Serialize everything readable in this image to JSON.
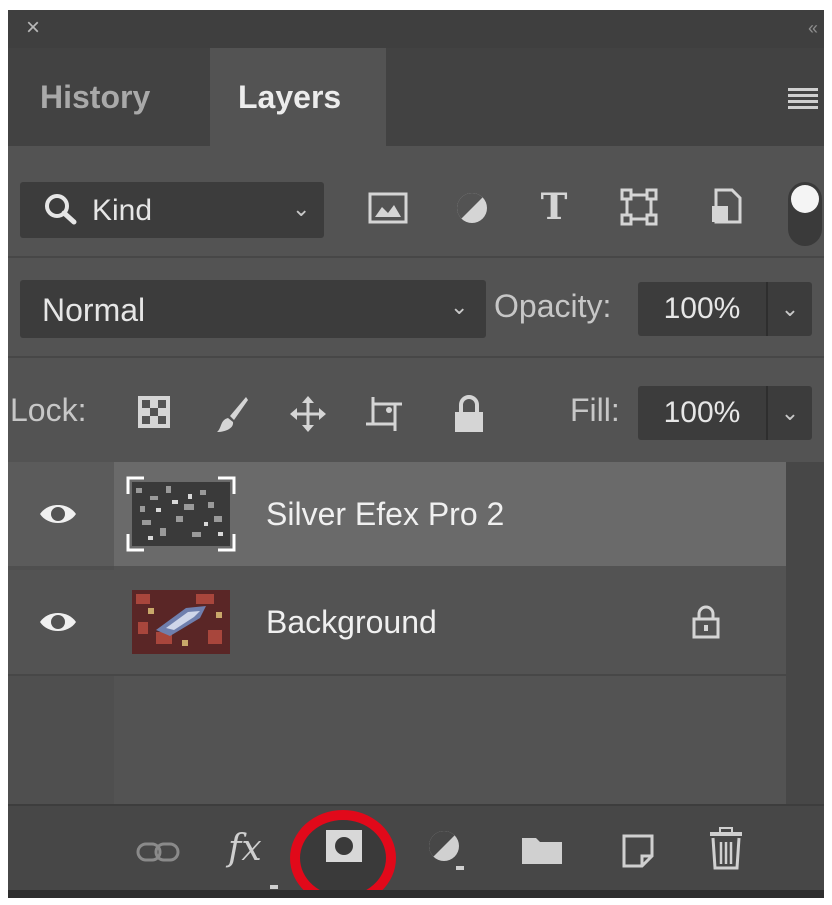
{
  "panel": {
    "close_glyph": "×",
    "collapse_glyph": "‹‹",
    "menu_icon": "panel-menu-icon"
  },
  "tabs": [
    {
      "label": "History",
      "active": false
    },
    {
      "label": "Layers",
      "active": true
    }
  ],
  "filter": {
    "kind_label": "Kind",
    "icons": [
      "image-filter-icon",
      "adjustment-filter-icon",
      "type-filter-icon",
      "shape-filter-icon",
      "smart-object-filter-icon"
    ],
    "toggle_on": true
  },
  "blend": {
    "mode": "Normal",
    "opacity_label": "Opacity:",
    "opacity_value": "100%"
  },
  "lock": {
    "label": "Lock:",
    "icons": [
      "lock-transparent-icon",
      "lock-image-icon",
      "lock-position-icon",
      "lock-artboard-icon",
      "lock-all-icon"
    ],
    "fill_label": "Fill:",
    "fill_value": "100%"
  },
  "layers": [
    {
      "name": "Silver Efex Pro 2",
      "visible": true,
      "selected": true,
      "locked": false
    },
    {
      "name": "Background",
      "visible": true,
      "selected": false,
      "locked": true
    }
  ],
  "bottom_toolbar": {
    "icons": [
      "link-layers-icon",
      "fx-icon",
      "add-layer-mask-icon",
      "new-adjustment-layer-icon",
      "new-group-icon",
      "new-layer-icon",
      "delete-layer-icon"
    ],
    "fx_text": "fx",
    "highlight_color": "#e1091a"
  }
}
